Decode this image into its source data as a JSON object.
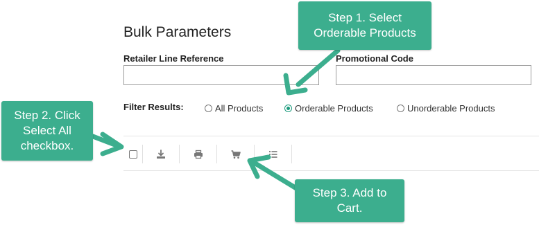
{
  "heading": "Bulk Parameters",
  "fields": {
    "retailer_line_reference": {
      "label": "Retailer Line Reference",
      "value": ""
    },
    "promotional_code": {
      "label": "Promotional Code",
      "value": ""
    }
  },
  "filter": {
    "label": "Filter Results:",
    "options": [
      {
        "label": "All Products",
        "checked": false
      },
      {
        "label": "Orderable Products",
        "checked": true
      },
      {
        "label": "Unorderable Products",
        "checked": false
      }
    ]
  },
  "toolbar": {
    "icons": [
      "select-all-checkbox",
      "download-icon",
      "print-icon",
      "cart-icon",
      "list-icon"
    ]
  },
  "callouts": {
    "step1": {
      "line1": "Step 1. Select",
      "line2": "Orderable Products"
    },
    "step2": {
      "line1": "Step 2. Click",
      "line2": "Select All",
      "line3": "checkbox."
    },
    "step3": {
      "line1": "Step 3. Add to",
      "line2": "Cart."
    }
  },
  "colors": {
    "accent": "#3cae8e",
    "radio_checked": "#1a9a7c",
    "icon": "#777777"
  }
}
